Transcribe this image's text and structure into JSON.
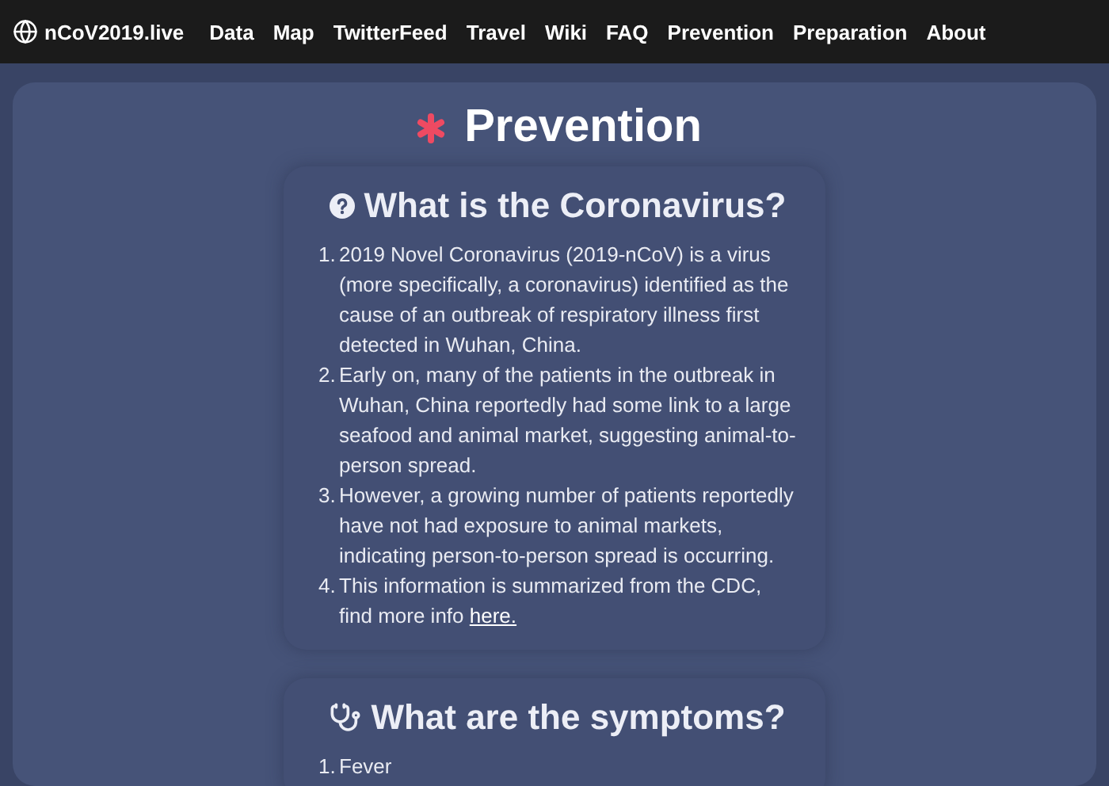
{
  "navbar": {
    "brand": "nCoV2019.live",
    "links": [
      {
        "label": "Data",
        "selected": false
      },
      {
        "label": "Map",
        "selected": false
      },
      {
        "label": "TwitterFeed",
        "selected": false
      },
      {
        "label": "Travel",
        "selected": false
      },
      {
        "label": "Wiki",
        "selected": false
      },
      {
        "label": "FAQ",
        "selected": false
      },
      {
        "label": "Prevention",
        "selected": false
      },
      {
        "label": "Preparation",
        "selected": false
      },
      {
        "label": "About",
        "selected": false
      }
    ]
  },
  "page_title": "Prevention",
  "sections": [
    {
      "kind": "question",
      "title": "What is the Coronavirus?",
      "items": [
        {
          "number": "1.",
          "text": "2019 Novel Coronavirus (2019-nCoV) is a virus (more specifically, a coronavirus) identified as the cause of an outbreak of respiratory illness first detected in Wuhan, China."
        },
        {
          "number": "2.",
          "text": "Early on, many of the patients in the outbreak in Wuhan, China reportedly had some link to a large seafood and animal market, suggesting animal-to-person spread."
        },
        {
          "number": "3.",
          "text": "However, a growing number of patients reportedly have not had exposure to animal markets, indicating person-to-person spread is occurring."
        },
        {
          "number": "4.",
          "text": "This information is summarized from the CDC, find more info",
          "link": "here."
        }
      ]
    },
    {
      "kind": "stethoscope",
      "title": "What are the symptoms?",
      "items": [
        {
          "number": "1.",
          "text": "Fever"
        }
      ]
    }
  ]
}
